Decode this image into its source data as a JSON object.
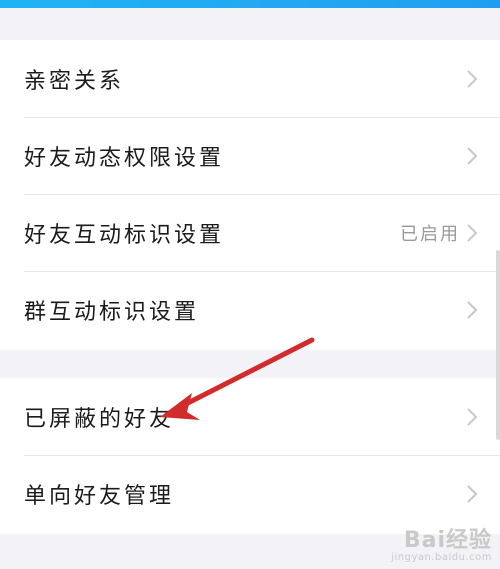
{
  "rows_group1": [
    {
      "label": "亲密关系"
    },
    {
      "label": "好友动态权限设置"
    },
    {
      "label": "好友互动标识设置",
      "status": "已启用"
    },
    {
      "label": "群互动标识设置"
    }
  ],
  "rows_group2": [
    {
      "label": "已屏蔽的好友"
    },
    {
      "label": "单向好友管理"
    }
  ],
  "watermark": {
    "main": "Bai经验",
    "sub": "jingyan.baidu.com"
  },
  "colors": {
    "accent": "#1fb3f5",
    "annotation_arrow": "#d12b2b",
    "chevron": "#c7c7cc"
  },
  "icons": {
    "chevron": "chevron-right-icon",
    "annotation": "red-arrow-annotation"
  }
}
